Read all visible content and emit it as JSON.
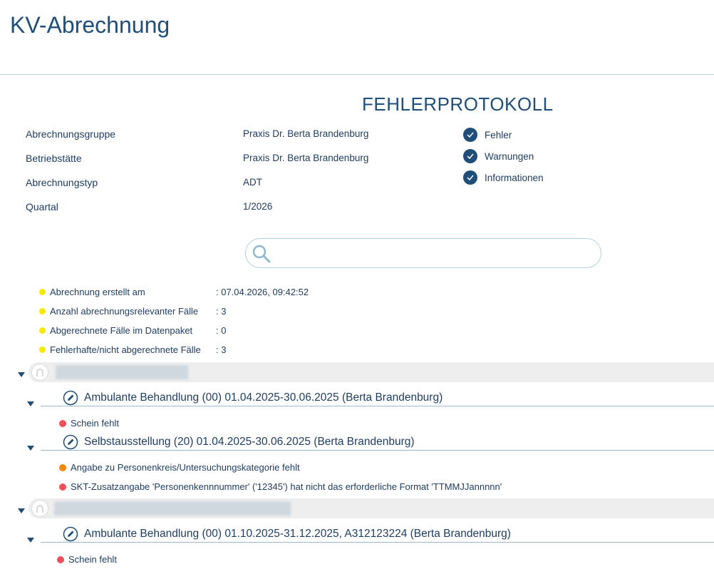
{
  "header": {
    "title": "KV-Abrechnung"
  },
  "protocol": {
    "title": "FEHLERPROTOKOLL"
  },
  "info": [
    {
      "label": "Abrechnungsgruppe",
      "value": "Praxis Dr. Berta Brandenburg"
    },
    {
      "label": "Betriebstätte",
      "value": "Praxis Dr. Berta Brandenburg"
    },
    {
      "label": "Abrechnungstyp",
      "value": "ADT"
    },
    {
      "label": "Quartal",
      "value": "1/2026"
    }
  ],
  "filters": [
    {
      "label": "Fehler",
      "checked": true
    },
    {
      "label": "Warnungen",
      "checked": true
    },
    {
      "label": "Informationen",
      "checked": true
    }
  ],
  "search": {
    "placeholder": "",
    "value": ""
  },
  "stats": [
    {
      "label": "Abrechnung erstellt am",
      "value": ": 07.04.2026, 09:42:52"
    },
    {
      "label": "Anzahl abrechnungsrelevanter Fälle",
      "value": ": 3"
    },
    {
      "label": "Abgerechnete Fälle im Datenpaket",
      "value": ": 0"
    },
    {
      "label": "Fehlerhafte/nicht abgerechnete Fälle",
      "value": ": 3"
    }
  ],
  "patients": [
    {
      "cases": [
        {
          "title": "Ambulante Behandlung (00) 01.04.2025-30.06.2025 (Berta Brandenburg)",
          "messages": [
            {
              "severity": "error",
              "text": "Schein fehlt"
            }
          ]
        },
        {
          "title": "Selbstausstellung (20) 01.04.2025-30.06.2025 (Berta Brandenburg)",
          "messages": [
            {
              "severity": "warning",
              "text": "Angabe zu Personenkreis/Untersuchungskategorie fehlt"
            },
            {
              "severity": "error",
              "text": "SKT-Zusatzangabe 'Personenkennnummer' ('12345') hat nicht das erforderliche Format 'TTMMJJannnnn'"
            }
          ]
        }
      ]
    },
    {
      "cases": [
        {
          "title": "Ambulante Behandlung (00) 01.10.2025-31.12.2025, A312123224 (Berta Brandenburg)",
          "messages": [
            {
              "severity": "error",
              "text": "Schein fehlt"
            }
          ]
        }
      ]
    }
  ],
  "colors": {
    "primary": "#1f4e79",
    "error": "#f0505a",
    "warning": "#ef8a0e",
    "info": "#f3ea00"
  }
}
